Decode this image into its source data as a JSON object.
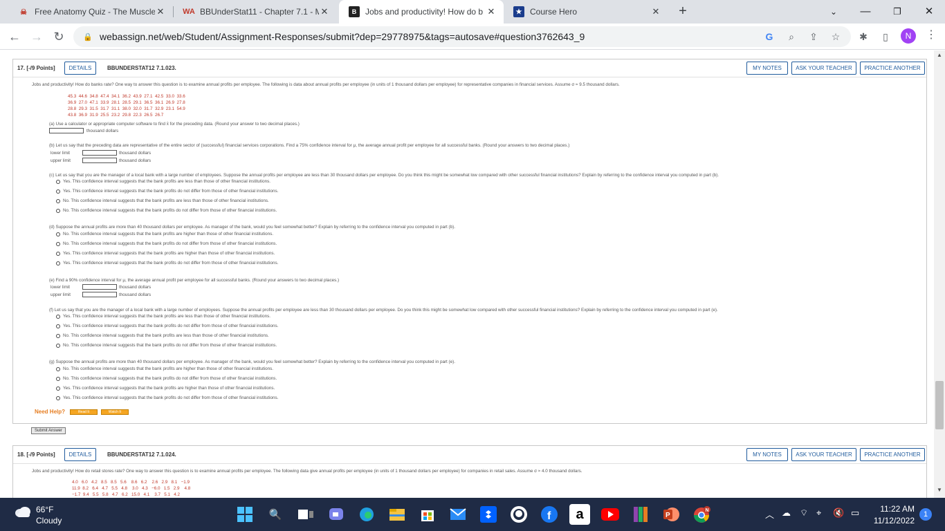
{
  "tabs": [
    {
      "title": "Free Anatomy Quiz - The Muscle",
      "icon": "anatomy-favicon"
    },
    {
      "title": "BBUnderStat11 - Chapter 7.1 - M",
      "icon": "webassign-favicon"
    },
    {
      "title": "Jobs and productivity! How do b",
      "icon": "bartleby-favicon"
    },
    {
      "title": "Course Hero",
      "icon": "coursehero-favicon"
    }
  ],
  "url": "webassign.net/web/Student/Assignment-Responses/submit?dep=29778975&tags=autosave#question3762643_9",
  "profile_initial": "N",
  "q17": {
    "label": "17. [-/9 Points]",
    "details": "DETAILS",
    "code": "BBUNDERSTAT12 7.1.023.",
    "my_notes": "MY NOTES",
    "ask_teacher": "ASK YOUR TEACHER",
    "practice": "PRACTICE ANOTHER",
    "intro": "Jobs and productivity! How do banks rate? One way to answer this question is to examine annual profits per employee. The following is data about annual profits per employee (in units of 1 thousand dollars per employee) for representative companies in financial services. Assume σ ≈ 9.5 thousand dollars.",
    "data_rows": [
      "45.3  44.6  34.8  47.4  34.1  36.2  43.9  27.1  42.5  33.0  33.6",
      "36.9  27.0  47.1  33.9  28.1  28.5  29.1  36.5  36.1  26.9  27.8",
      "28.8  29.3  31.5  31.7  31.1  38.0  32.0  31.7  32.9  23.1  54.9",
      "43.8  36.9  31.9  25.5  23.2  29.8  22.3  26.5  26.7"
    ],
    "a_text": "(a) Use a calculator or appropriate computer software to find x̄ for the preceding data. (Round your answer to two decimal places.)",
    "unit": "thousand dollars",
    "b_text": "(b) Let us say that the preceding data are representative of the entire sector of (successful) financial services corporations. Find a 75% confidence interval for μ, the average annual profit per employee for all successful banks. (Round your answers to two decimal places.)",
    "lower": "lower limit",
    "upper": "upper limit",
    "c_text": "(c) Let us say that you are the manager of a local bank with a large number of employees. Suppose the annual profits per employee are less than 30 thousand dollars per employee. Do you think this might be somewhat low compared with other successful financial institutions? Explain by referring to the confidence interval you computed in part (b).",
    "c_opts": [
      "Yes. This confidence interval suggests that the bank profits are less than those of other financial institutions.",
      "Yes. This confidence interval suggests that the bank profits do not differ from those of other financial institutions.",
      "No. This confidence interval suggests that the bank profits are less than those of other financial institutions.",
      "No. This confidence interval suggests that the bank profits do not differ from those of other financial institutions."
    ],
    "d_text": "(d) Suppose the annual profits are more than 40 thousand dollars per employee. As manager of the bank, would you feel somewhat better? Explain by referring to the confidence interval you computed in part (b).",
    "d_opts": [
      "No. This confidence interval suggests that the bank profits are higher than those of other financial institutions.",
      "No. This confidence interval suggests that the bank profits do not differ from those of other financial institutions.",
      "Yes. This confidence interval suggests that the bank profits are higher than those of other financial institutions.",
      "Yes. This confidence interval suggests that the bank profits do not differ from those of other financial institutions."
    ],
    "e_text": "(e) Find a 90% confidence interval for μ, the average annual profit per employee for all successful banks. (Round your answers to two decimal places.)",
    "f_text": "(f) Let us say that you are the manager of a local bank with a large number of employees. Suppose the annual profits per employee are less than 30 thousand dollars per employee. Do you think this might be somewhat low compared with other successful financial institutions? Explain by referring to the confidence interval you computed in part (e).",
    "f_opts": [
      "Yes. This confidence interval suggests that the bank profits are less than those of other financial institutions.",
      "Yes. This confidence interval suggests that the bank profits do not differ from those of other financial institutions.",
      "No. This confidence interval suggests that the bank profits are less than those of other financial institutions.",
      "No. This confidence interval suggests that the bank profits do not differ from those of other financial institutions."
    ],
    "g_text": "(g) Suppose the annual profits are more than 40 thousand dollars per employee. As manager of the bank, would you feel somewhat better? Explain by referring to the confidence interval you computed in part (e).",
    "g_opts": [
      "No. This confidence interval suggests that the bank profits are higher than those of other financial institutions.",
      "No. This confidence interval suggests that the bank profits do not differ from those of other financial institutions.",
      "Yes. This confidence interval suggests that the bank profits are higher than those of other financial institutions.",
      "Yes. This confidence interval suggests that the bank profits do not differ from those of other financial institutions."
    ],
    "need_help": "Need Help?",
    "read_it": "Read It",
    "watch_it": "Watch It",
    "submit": "Submit Answer"
  },
  "q18": {
    "label": "18. [-/9 Points]",
    "details": "DETAILS",
    "code": "BBUNDERSTAT12 7.1.024.",
    "my_notes": "MY NOTES",
    "ask_teacher": "ASK YOUR TEACHER",
    "practice": "PRACTICE ANOTHER",
    "intro": "Jobs and productivity! How do retail stores rate? One way to answer this question is to examine annual profits per employee. The following data give annual profits per employee (in units of 1 thousand dollars per employee) for companies in retail sales. Assume σ ≈ 4.0 thousand dollars.",
    "data_rows": [
      "4.0   6.0   4.2   8.5   8.5   5.6    8.6   6.2    2.6   2.9   8.1   −1.9",
      "11.9  8.2   6.4   4.7   5.5   4.8    3.0   4.3   −6.0   1.5   2.9    4.8",
      "−1.7  9.4   5.5   5.8   4.7   6.2   15.0   4.1    3.7   5.1   4.2"
    ]
  },
  "taskbar": {
    "temp": "66°F",
    "weather": "Cloudy",
    "time": "11:22 AM",
    "date": "11/12/2022",
    "notifications": "1"
  }
}
